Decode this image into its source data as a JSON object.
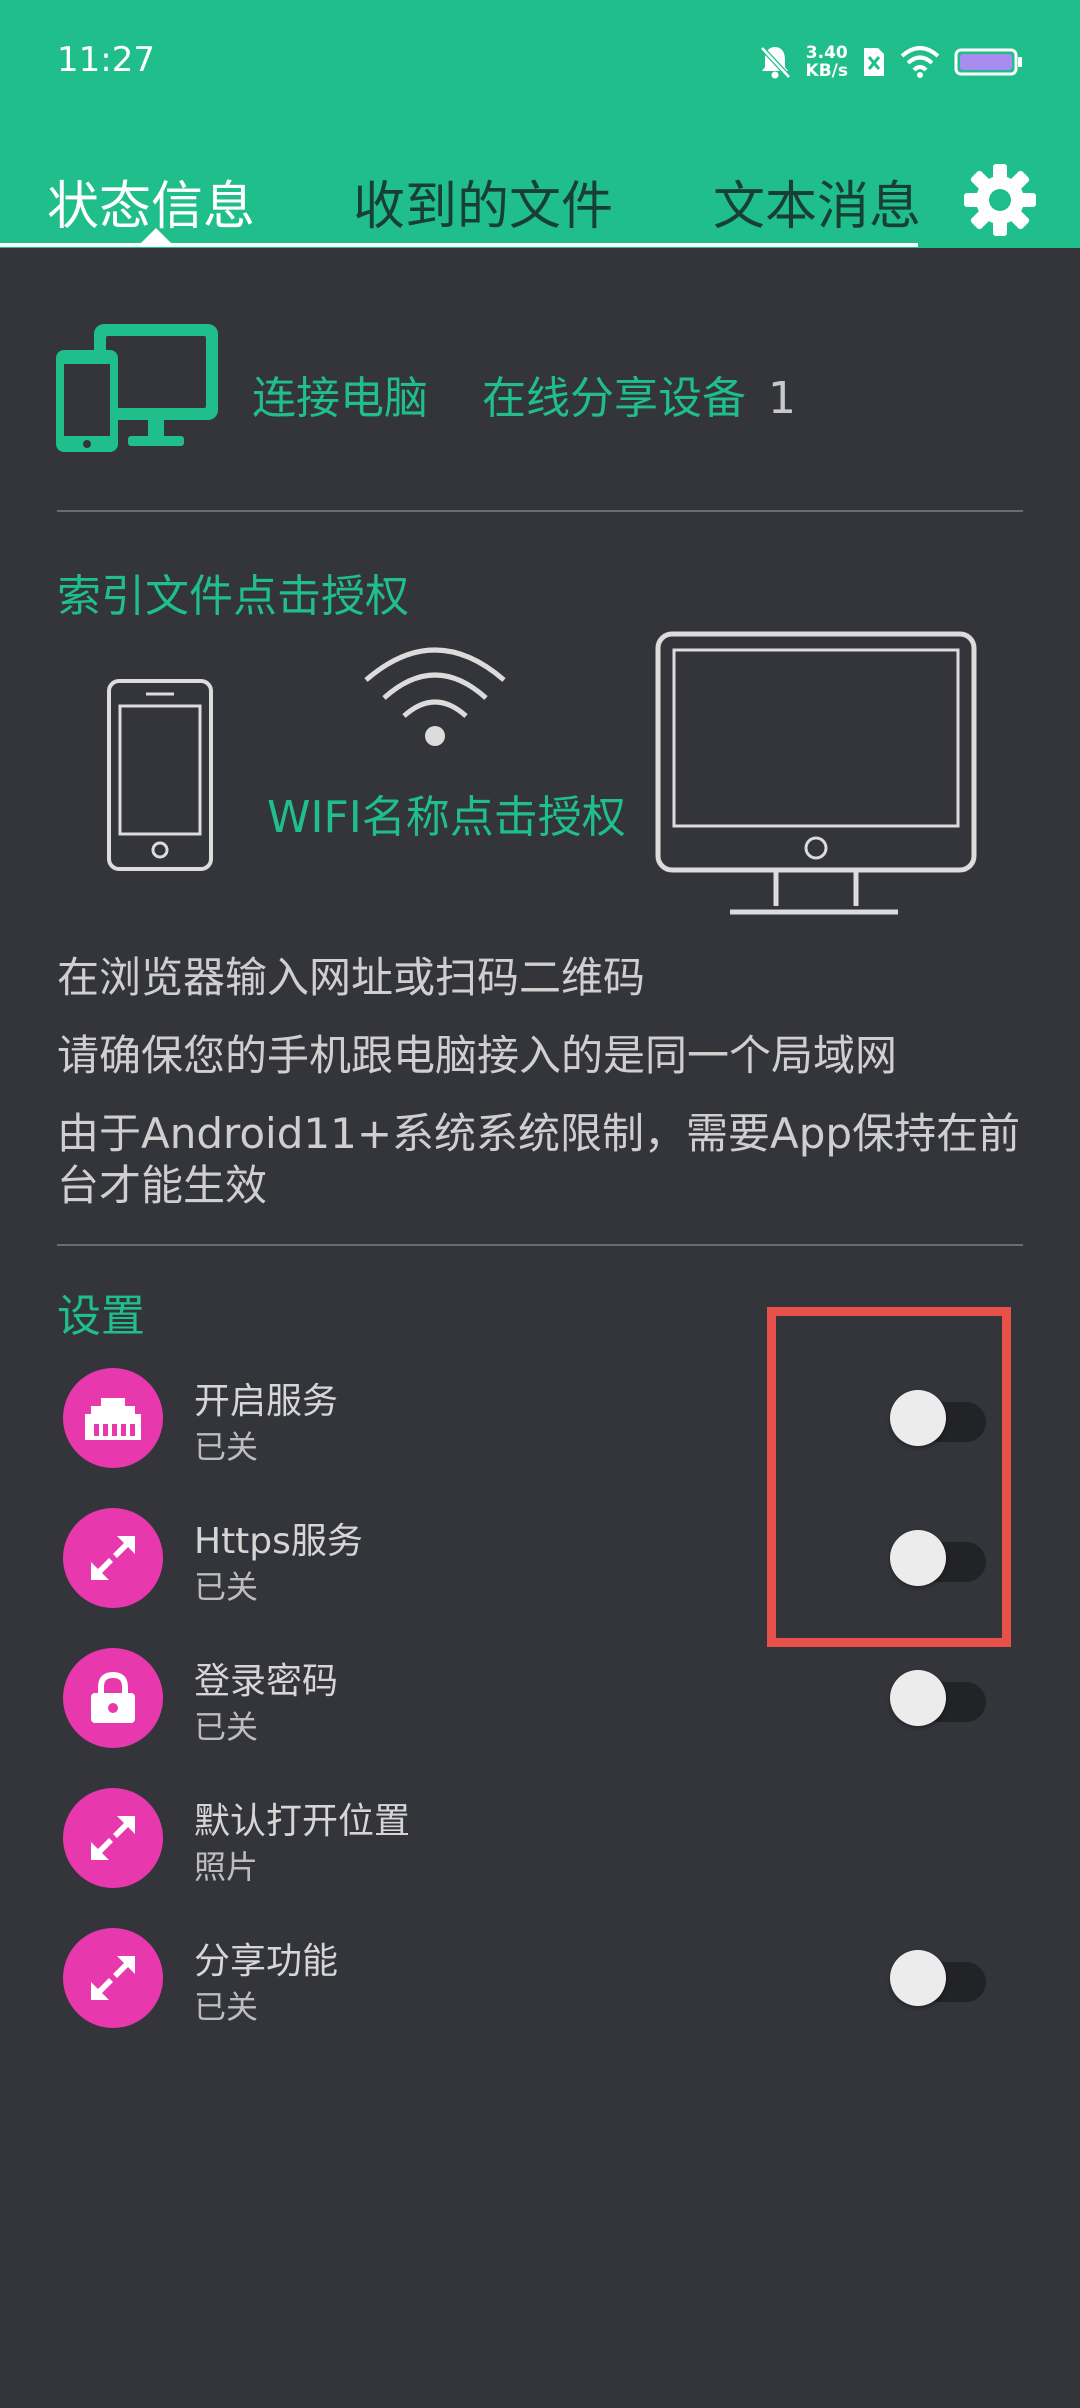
{
  "status_bar": {
    "time": "11:27",
    "net_speed_value": "3.40",
    "net_speed_unit": "KB/s"
  },
  "tabs": [
    {
      "label": "状态信息",
      "active": true
    },
    {
      "label": "收到的文件",
      "active": false
    },
    {
      "label": "文本消息",
      "active": false
    }
  ],
  "connection": {
    "label": "连接电脑",
    "online_label": "在线分享设备",
    "online_count": "1"
  },
  "index_link": "索引文件点击授权",
  "wifi_link": "WIFI名称点击授权",
  "info_lines": [
    "在浏览器输入网址或扫码二维码",
    "请确保您的手机跟电脑接入的是同一个局域网",
    "由于Android11+系统系统限制，需要App保持在前台才能生效"
  ],
  "settings_title": "设置",
  "settings": [
    {
      "title": "开启服务",
      "subtitle": "已关",
      "icon": "ethernet-icon",
      "has_toggle": true,
      "on": false
    },
    {
      "title": "Https服务",
      "subtitle": "已关",
      "icon": "expand-arrows-icon",
      "has_toggle": true,
      "on": false
    },
    {
      "title": "登录密码",
      "subtitle": "已关",
      "icon": "lock-icon",
      "has_toggle": true,
      "on": false
    },
    {
      "title": "默认打开位置",
      "subtitle": "照片",
      "icon": "expand-arrows-icon",
      "has_toggle": false
    },
    {
      "title": "分享功能",
      "subtitle": "已关",
      "icon": "expand-arrows-icon",
      "has_toggle": true,
      "on": false
    }
  ],
  "colors": {
    "accent": "#20be8a",
    "background": "#34353b",
    "setting_icon": "#e838ad",
    "highlight": "#e8514a"
  }
}
